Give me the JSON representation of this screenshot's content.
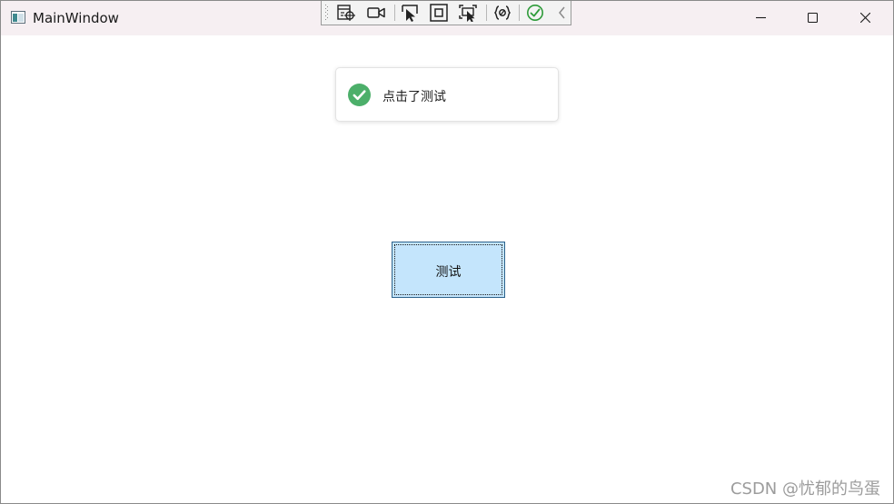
{
  "window": {
    "title": "MainWindow",
    "icon": "window-app-icon"
  },
  "debug_toolbar": {
    "items": [
      {
        "icon": "select-element-icon"
      },
      {
        "icon": "record-camera-icon"
      },
      {
        "icon": "cursor-select-icon"
      },
      {
        "icon": "display-layout-adorner-icon"
      },
      {
        "icon": "track-focus-icon"
      },
      {
        "icon": "binding-failures-icon"
      },
      {
        "icon": "check-circle-icon"
      },
      {
        "icon": "collapse-chevron-icon"
      }
    ]
  },
  "window_controls": {
    "minimize": "minimize-icon",
    "maximize": "maximize-icon",
    "close": "close-icon"
  },
  "toast": {
    "icon": "success-check-icon",
    "message": "点击了测试",
    "accent_color": "#4caf6a"
  },
  "main": {
    "test_button_label": "测试",
    "button_color": "#c4e5fc"
  },
  "watermark": "CSDN @忧郁的鸟蛋"
}
